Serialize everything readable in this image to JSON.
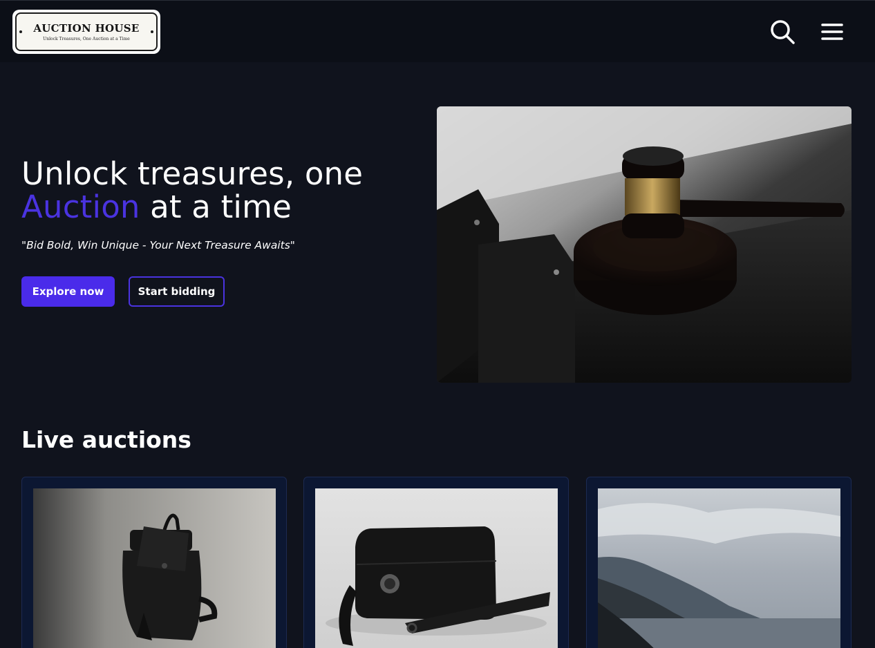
{
  "header": {
    "logo": {
      "title": "AUCTION HOUSE",
      "tagline": "Unlock Treasures, One Auction at a Time"
    },
    "icons": [
      "search-icon",
      "hamburger-menu-icon"
    ]
  },
  "hero": {
    "title_line1": "Unlock treasures, one",
    "title_accent": "Auction",
    "title_rest": " at a time",
    "subtitle": "\"Bid Bold, Win Unique - Your Next Treasure Awaits\"",
    "primary_button": "Explore now",
    "secondary_button": "Start bidding",
    "image": "gavel-photo"
  },
  "live_auctions": {
    "title": "Live auctions",
    "cards": [
      {
        "image": "black-backpack-photo"
      },
      {
        "image": "black-clutch-bag-photo"
      },
      {
        "image": "coastal-mountains-photo"
      }
    ]
  },
  "colors": {
    "background": "#10131d",
    "header": "#0c0f17",
    "accent": "#4a2bea",
    "card_background": "#0c1732"
  }
}
